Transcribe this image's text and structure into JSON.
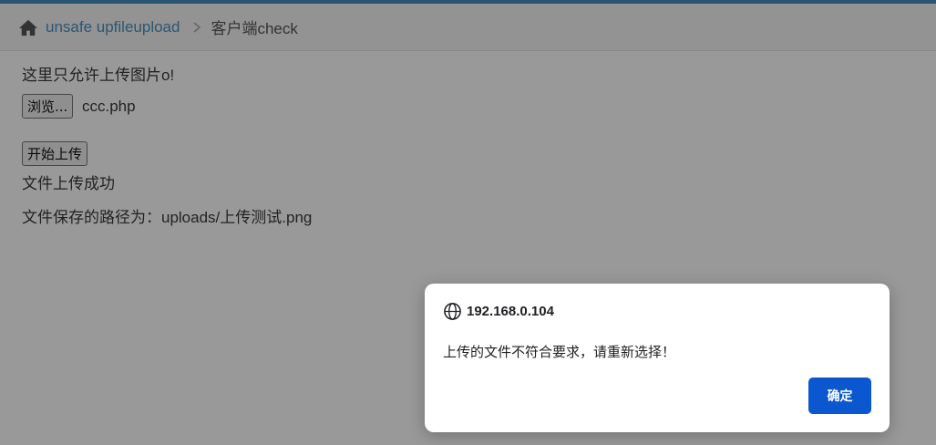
{
  "breadcrumb": {
    "home_icon": "home-icon",
    "link_label": "unsafe upfileupload",
    "separator_icon": "chevron-right-icon",
    "current_label": "客户端check"
  },
  "content": {
    "intro_text": "这里只允许上传图片o!",
    "browse_button": "浏览...",
    "selected_file": "ccc.php",
    "upload_button": "开始上传",
    "success_text": "文件上传成功",
    "path_text": "文件保存的路径为：uploads/上传测试.png"
  },
  "dialog": {
    "icon": "globe-icon",
    "title": "192.168.0.104",
    "message": "上传的文件不符合要求，请重新选择！",
    "ok_label": "确定"
  },
  "colors": {
    "accent": "#438eb9",
    "link": "#4c8fbd",
    "dialog_button": "#0b57d0"
  }
}
